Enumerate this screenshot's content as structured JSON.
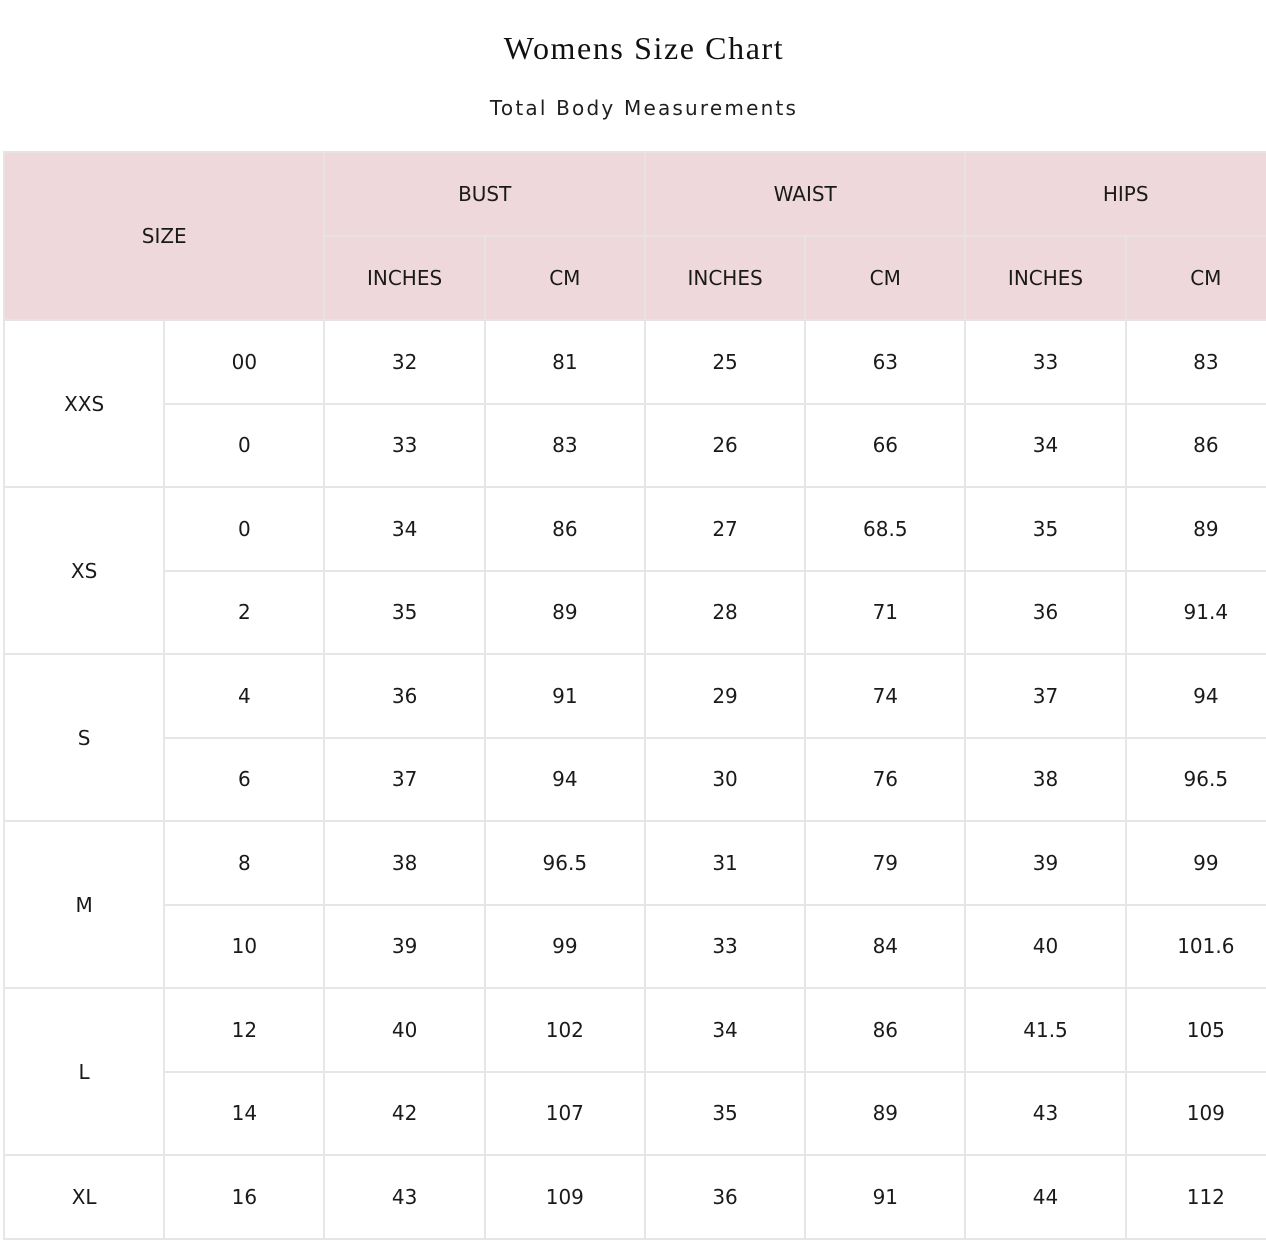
{
  "title": "Womens Size Chart",
  "subtitle": "Total Body Measurements",
  "colors": {
    "header_background": "#eed8db",
    "grid_line": "#e6e6e6",
    "text": "#1a1a1a"
  },
  "table": {
    "size_header": "SIZE",
    "groups": [
      "BUST",
      "WAIST",
      "HIPS"
    ],
    "units": [
      "INCHES",
      "CM"
    ],
    "rows": [
      {
        "letter": "XXS",
        "number": "00",
        "bust_in": "32",
        "bust_cm": "81",
        "waist_in": "25",
        "waist_cm": "63",
        "hips_in": "33",
        "hips_cm": "83"
      },
      {
        "letter": "XXS",
        "number": "0",
        "bust_in": "33",
        "bust_cm": "83",
        "waist_in": "26",
        "waist_cm": "66",
        "hips_in": "34",
        "hips_cm": "86"
      },
      {
        "letter": "XS",
        "number": "0",
        "bust_in": "34",
        "bust_cm": "86",
        "waist_in": "27",
        "waist_cm": "68.5",
        "hips_in": "35",
        "hips_cm": "89"
      },
      {
        "letter": "XS",
        "number": "2",
        "bust_in": "35",
        "bust_cm": "89",
        "waist_in": "28",
        "waist_cm": "71",
        "hips_in": "36",
        "hips_cm": "91.4"
      },
      {
        "letter": "S",
        "number": "4",
        "bust_in": "36",
        "bust_cm": "91",
        "waist_in": "29",
        "waist_cm": "74",
        "hips_in": "37",
        "hips_cm": "94"
      },
      {
        "letter": "S",
        "number": "6",
        "bust_in": "37",
        "bust_cm": "94",
        "waist_in": "30",
        "waist_cm": "76",
        "hips_in": "38",
        "hips_cm": "96.5"
      },
      {
        "letter": "M",
        "number": "8",
        "bust_in": "38",
        "bust_cm": "96.5",
        "waist_in": "31",
        "waist_cm": "79",
        "hips_in": "39",
        "hips_cm": "99"
      },
      {
        "letter": "M",
        "number": "10",
        "bust_in": "39",
        "bust_cm": "99",
        "waist_in": "33",
        "waist_cm": "84",
        "hips_in": "40",
        "hips_cm": "101.6"
      },
      {
        "letter": "L",
        "number": "12",
        "bust_in": "40",
        "bust_cm": "102",
        "waist_in": "34",
        "waist_cm": "86",
        "hips_in": "41.5",
        "hips_cm": "105"
      },
      {
        "letter": "L",
        "number": "14",
        "bust_in": "42",
        "bust_cm": "107",
        "waist_in": "35",
        "waist_cm": "89",
        "hips_in": "43",
        "hips_cm": "109"
      },
      {
        "letter": "XL",
        "number": "16",
        "bust_in": "43",
        "bust_cm": "109",
        "waist_in": "36",
        "waist_cm": "91",
        "hips_in": "44",
        "hips_cm": "112"
      }
    ]
  }
}
